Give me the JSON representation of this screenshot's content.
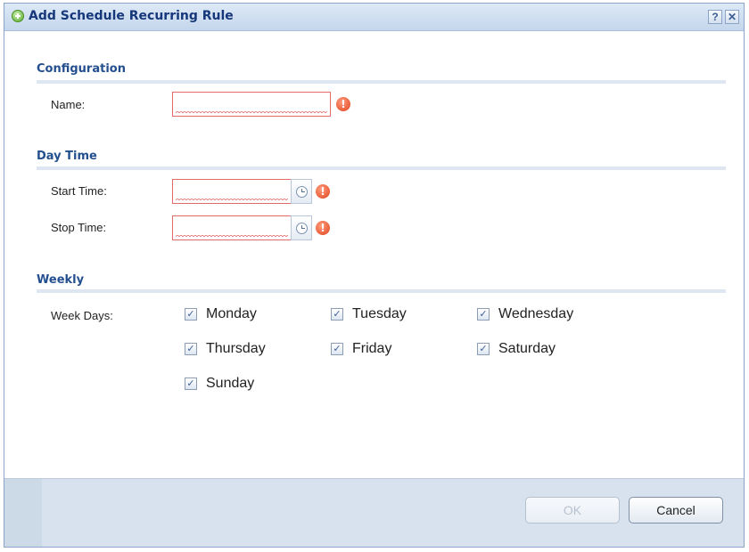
{
  "dialog": {
    "title": "Add Schedule Recurring Rule",
    "help_label": "?",
    "close_label": "✕"
  },
  "configuration": {
    "section_title": "Configuration",
    "name_label": "Name:",
    "name_value": ""
  },
  "day_time": {
    "section_title": "Day Time",
    "start_label": "Start Time:",
    "start_value": "",
    "stop_label": "Stop Time:",
    "stop_value": ""
  },
  "weekly": {
    "section_title": "Weekly",
    "week_days_label": "Week Days:",
    "days": [
      {
        "label": "Monday",
        "checked": true
      },
      {
        "label": "Tuesday",
        "checked": true
      },
      {
        "label": "Wednesday",
        "checked": true
      },
      {
        "label": "Thursday",
        "checked": true
      },
      {
        "label": "Friday",
        "checked": true
      },
      {
        "label": "Saturday",
        "checked": true
      },
      {
        "label": "Sunday",
        "checked": true
      }
    ]
  },
  "warning_glyph": "!",
  "check_glyph": "✓",
  "buttons": {
    "ok_label": "OK",
    "ok_enabled": false,
    "cancel_label": "Cancel"
  },
  "icons": {
    "title": "add-circle-icon",
    "help": "help-icon",
    "close": "close-icon",
    "clock": "clock-icon",
    "warning": "warning-icon",
    "checkbox": "checkbox-checked-icon"
  },
  "colors": {
    "title_text": "#16377a",
    "section_title": "#244f8f",
    "error_border": "#e46a6a",
    "warning": "#e0421c",
    "footer_bg": "#d7e2ee"
  }
}
